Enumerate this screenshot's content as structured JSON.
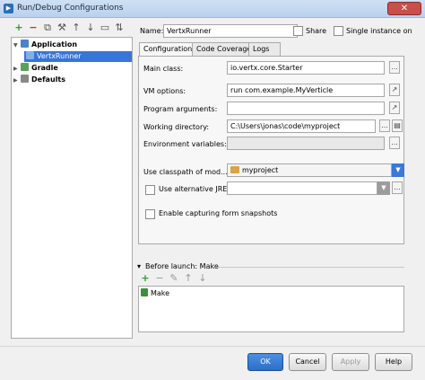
{
  "window": {
    "title": "Run/Debug Configurations",
    "close_glyph": "✕"
  },
  "toolbar": {
    "add": "+",
    "remove": "−",
    "copy": "⧉",
    "settings": "⚒",
    "up": "↑",
    "down": "↓",
    "folder": "▭",
    "sort": "⇅"
  },
  "tree": {
    "items": [
      {
        "label": "Application",
        "expanded": true
      },
      {
        "label": "VertxRunner",
        "selected": true
      },
      {
        "label": "Gradle",
        "expanded": false
      },
      {
        "label": "Defaults",
        "expanded": false
      }
    ]
  },
  "header": {
    "name_label": "Name:",
    "name_value": "VertxRunner",
    "share_label": "Share",
    "single_instance_label": "Single instance on"
  },
  "tabs": [
    {
      "label": "Configuration",
      "active": true
    },
    {
      "label": "Code Coverage"
    },
    {
      "label": "Logs"
    }
  ],
  "config": {
    "main_class_label": "Main class:",
    "main_class_value": "io.vertx.core.Starter",
    "vm_options_label": "VM options:",
    "vm_options_value": "run com.example.MyVerticle",
    "program_args_label": "Program arguments:",
    "program_args_value": "",
    "working_dir_label": "Working directory:",
    "working_dir_value": "C:\\Users\\jonas\\code\\myproject",
    "env_vars_label": "Environment variables:",
    "env_vars_value": "",
    "classpath_label": "Use classpath of mod...",
    "classpath_value": "myproject",
    "alt_jre_label": "Use alternative JRE:",
    "alt_jre_value": "",
    "form_snapshots_label": "Enable capturing form snapshots",
    "ellipsis": "...",
    "expand_glyph": "↗"
  },
  "before_launch": {
    "title": "Before launch: Make",
    "items": [
      "Make"
    ]
  },
  "buttons": {
    "ok": "OK",
    "cancel": "Cancel",
    "apply": "Apply",
    "help": "Help"
  },
  "colors": {
    "selection": "#3875d7",
    "primary_button": "#2c6fc7",
    "title_bar": "#c3d8f1"
  }
}
